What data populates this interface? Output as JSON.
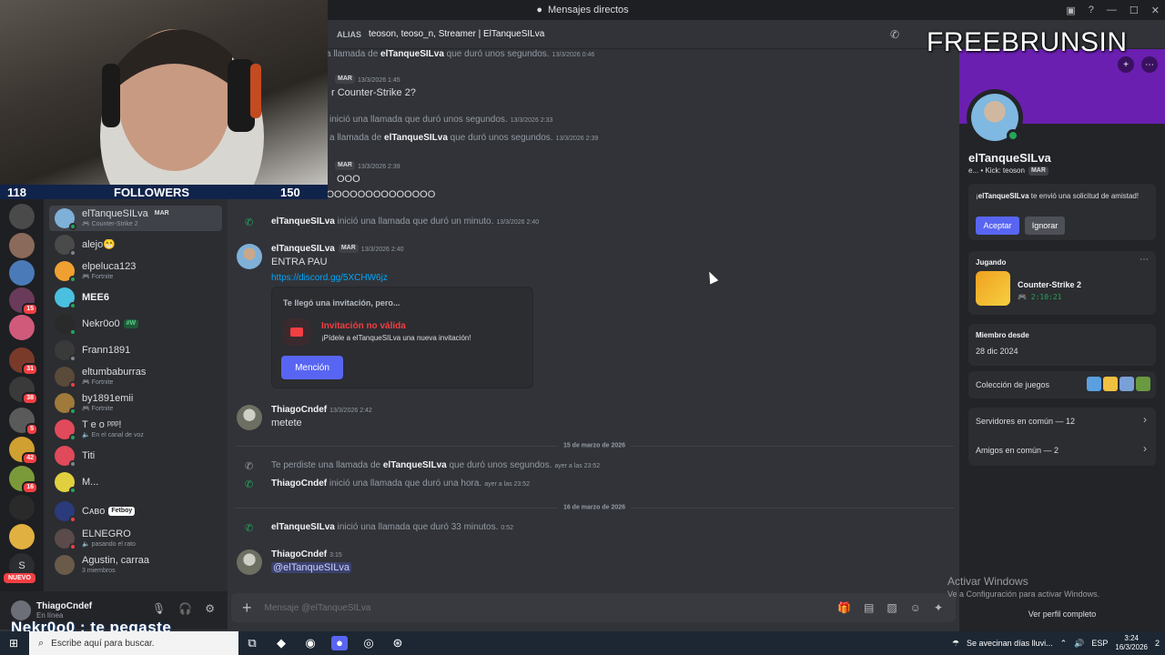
{
  "window": {
    "title": "Mensajes directos"
  },
  "stream": {
    "followers_count": "118",
    "followers_label": "FOLLOWERS",
    "followers_goal": "150",
    "overlay_title": "FREEBRUNSIN",
    "overlay_alert": "Nekr0o0 : te pegaste"
  },
  "header": {
    "alias_label": "ALIAS",
    "aliases": "teoson, teoso_n, Streamer | ElTanqueSILva"
  },
  "servers": [
    {
      "badge": ""
    },
    {
      "badge": ""
    },
    {
      "badge": ""
    },
    {
      "badge": "15"
    },
    {
      "badge": ""
    },
    {
      "badge": "31"
    },
    {
      "badge": "38"
    },
    {
      "badge": "5"
    },
    {
      "badge": "42"
    },
    {
      "badge": "16"
    },
    {
      "badge": ""
    },
    {
      "badge": ""
    },
    {
      "badge": "S"
    }
  ],
  "nuevo_label": "NUEVO",
  "dm_list": [
    {
      "name": "elTanqueSILva",
      "tag": "MAR",
      "sub": "Counter-Strike 2"
    },
    {
      "name": "alejo😁",
      "tag": "",
      "sub": ""
    },
    {
      "name": "elpeluca123",
      "tag": "",
      "sub": "Fortnite"
    },
    {
      "name": "MEE6",
      "tag": "",
      "sub": ""
    },
    {
      "name": "Nekr0o0",
      "tag": "#W",
      "sub": ""
    },
    {
      "name": "Frann1891",
      "tag": "",
      "sub": ""
    },
    {
      "name": "eltumbaburras",
      "tag": "",
      "sub": "Fortnite"
    },
    {
      "name": "by1891emii",
      "tag": "",
      "sub": "Fortnite"
    },
    {
      "name": "T e o ᵖᵖᵖ!",
      "tag": "",
      "sub": "En el canal de voz"
    },
    {
      "name": "Titi",
      "tag": "",
      "sub": ""
    },
    {
      "name": "M...",
      "tag": "",
      "sub": ""
    },
    {
      "name": "Cᴀʙᴏ",
      "tag": "Fetboy",
      "sub": ""
    },
    {
      "name": "ELNEGRO",
      "tag": "",
      "sub": "pasando el rato"
    },
    {
      "name": "Agustin, carraa",
      "tag": "",
      "sub": "3 miembros"
    }
  ],
  "user_panel": {
    "name": "ThiagoCndef",
    "status": "En línea"
  },
  "messages": {
    "sys1": {
      "pre": "",
      "bold": "elTanqueSILva",
      "mid": "a llamada de ",
      "post": " que duró unos segundos.",
      "ts": "13/3/2026 0:46"
    },
    "m1": {
      "tag": "MAR",
      "ts": "13/3/2026 1:45",
      "text": "r Counter-Strike 2?"
    },
    "sys2": {
      "text": "inició una llamada que duró unos segundos.",
      "ts": "13/3/2026 2:33"
    },
    "sys3": {
      "mid": "a llamada de ",
      "bold": "elTanqueSILva",
      "post": " que duró unos segundos.",
      "ts": "13/3/2026 2:39"
    },
    "m2": {
      "tag": "MAR",
      "ts": "13/3/2026 2:39",
      "line1": "OOO",
      "line2": "MOOOOOOOOOOOOOOOOOOOO"
    },
    "sys4": {
      "bold": "elTanqueSILva",
      "post": " inició una llamada que duró un minuto.",
      "ts": "13/3/2026 2:40"
    },
    "m3": {
      "author": "elTanqueSILva",
      "tag": "MAR",
      "ts": "13/3/2026 2:40",
      "text": "ENTRA PAU",
      "link": "https://discord.gg/5XCHW6jz"
    },
    "invite": {
      "header": "Te llegó una invitación, pero...",
      "title": "Invitación no válida",
      "desc": "¡Pídele a elTanqueSILva una nueva invitación!",
      "button": "Mención"
    },
    "m4": {
      "author": "ThiagoCndef",
      "ts": "13/3/2026 2:42",
      "text": "metete"
    },
    "div1": "15 de marzo de 2026",
    "sys5": {
      "pre": "Te perdiste una llamada de ",
      "bold": "elTanqueSILva",
      "post": " que duró unos segundos.",
      "ts": "ayer a las 23:52"
    },
    "sys6": {
      "bold": "ThiagoCndef",
      "post": " inició una llamada que duró una hora.",
      "ts": "ayer a las 23:52"
    },
    "div2": "16 de marzo de 2026",
    "sys7": {
      "bold": "elTanqueSILva",
      "post": " inició una llamada que duró 33 minutos.",
      "ts": "0:52"
    },
    "m5": {
      "author": "ThiagoCndef",
      "ts": "3:15",
      "mention": "@elTanqueSILva"
    }
  },
  "composer": {
    "placeholder": "Mensaje @elTanqueSILva"
  },
  "profile": {
    "name": "elTanqueSILva",
    "sub": "e... • Kick: teoson",
    "tag": "MAR",
    "friend_request": {
      "bold": "elTanqueSILva",
      "text": " te envió una solicitud de amistad!",
      "pre": "¡",
      "accept": "Aceptar",
      "ignore": "Ignorar"
    },
    "playing_label": "Jugando",
    "game": "Counter-Strike 2",
    "game_time": "2:10:21",
    "member_since_label": "Miembro desde",
    "member_since": "28 dic 2024",
    "games_collection": "Colección de juegos",
    "servers_common": "Servidores en común — 12",
    "friends_common": "Amigos en común — 2",
    "view_full": "Ver perfil completo"
  },
  "windows_activation": {
    "title": "Activar Windows",
    "sub": "Ve a Configuración para activar Windows."
  },
  "taskbar": {
    "search_placeholder": "Escribe aquí para buscar.",
    "weather": "Se avecinan días lluvi...",
    "lang": "ESP",
    "time": "3:24",
    "date": "16/3/2026",
    "notif": "2"
  },
  "colors": {
    "accent": "#5865f2",
    "online": "#23a55a",
    "danger": "#f23f43",
    "banner": "#6a1fb0"
  }
}
